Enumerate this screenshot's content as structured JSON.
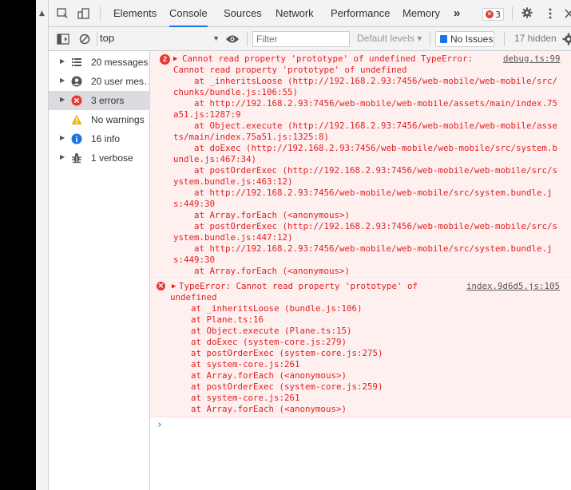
{
  "tabs": {
    "elements": "Elements",
    "console": "Console",
    "sources": "Sources",
    "network": "Network",
    "performance": "Performance",
    "memory": "Memory",
    "more": "»",
    "error_count": "3"
  },
  "toolbar": {
    "context": "top",
    "filter_placeholder": "Filter",
    "levels": "Default levels ▾",
    "issues": "No Issues",
    "hidden": "17 hidden"
  },
  "sidebar": {
    "items": [
      {
        "label": "20 messages",
        "icon": "list-icon"
      },
      {
        "label": "20 user mes…",
        "icon": "user-icon"
      },
      {
        "label": "3 errors",
        "icon": "error-icon"
      },
      {
        "label": "No warnings",
        "icon": "warning-icon"
      },
      {
        "label": "16 info",
        "icon": "info-icon"
      },
      {
        "label": "1 verbose",
        "icon": "bug-icon"
      }
    ]
  },
  "messages": [
    {
      "repeat_count": "2",
      "source": "debug.ts:99",
      "lines": [
        "Cannot read property 'prototype' of undefined TypeError:",
        "Cannot read property 'prototype' of undefined",
        "    at _inheritsLoose (http://192.168.2.93:7456/web-mobile/web-mobile/src/",
        "chunks/bundle.js:106:55)",
        "    at http://192.168.2.93:7456/web-mobile/web-mobile/assets/main/index.75",
        "a51.js:1287:9",
        "    at Object.execute (http://192.168.2.93:7456/web-mobile/web-mobile/asse",
        "ts/main/index.75a51.js:1325:8)",
        "    at doExec (http://192.168.2.93:7456/web-mobile/web-mobile/src/system.b",
        "undle.js:467:34)",
        "    at postOrderExec (http://192.168.2.93:7456/web-mobile/web-mobile/src/s",
        "ystem.bundle.js:463:12)",
        "    at http://192.168.2.93:7456/web-mobile/web-mobile/src/system.bundle.j",
        "s:449:30",
        "    at Array.forEach (<anonymous>)",
        "    at postOrderExec (http://192.168.2.93:7456/web-mobile/web-mobile/src/s",
        "ystem.bundle.js:447:12)",
        "    at http://192.168.2.93:7456/web-mobile/web-mobile/src/system.bundle.j",
        "s:449:30",
        "    at Array.forEach (<anonymous>)"
      ]
    },
    {
      "source": "index.9d6d5.js:105",
      "lines": [
        "TypeError: Cannot read property 'prototype' of",
        "undefined",
        "    at _inheritsLoose (bundle.js:106)",
        "    at Plane.ts:16",
        "    at Object.execute (Plane.ts:15)",
        "    at doExec (system-core.js:279)",
        "    at postOrderExec (system-core.js:275)",
        "    at system-core.js:261",
        "    at Array.forEach (<anonymous>)",
        "    at postOrderExec (system-core.js:259)",
        "    at system-core.js:261",
        "    at Array.forEach (<anonymous>)"
      ]
    }
  ],
  "prompt": "›"
}
